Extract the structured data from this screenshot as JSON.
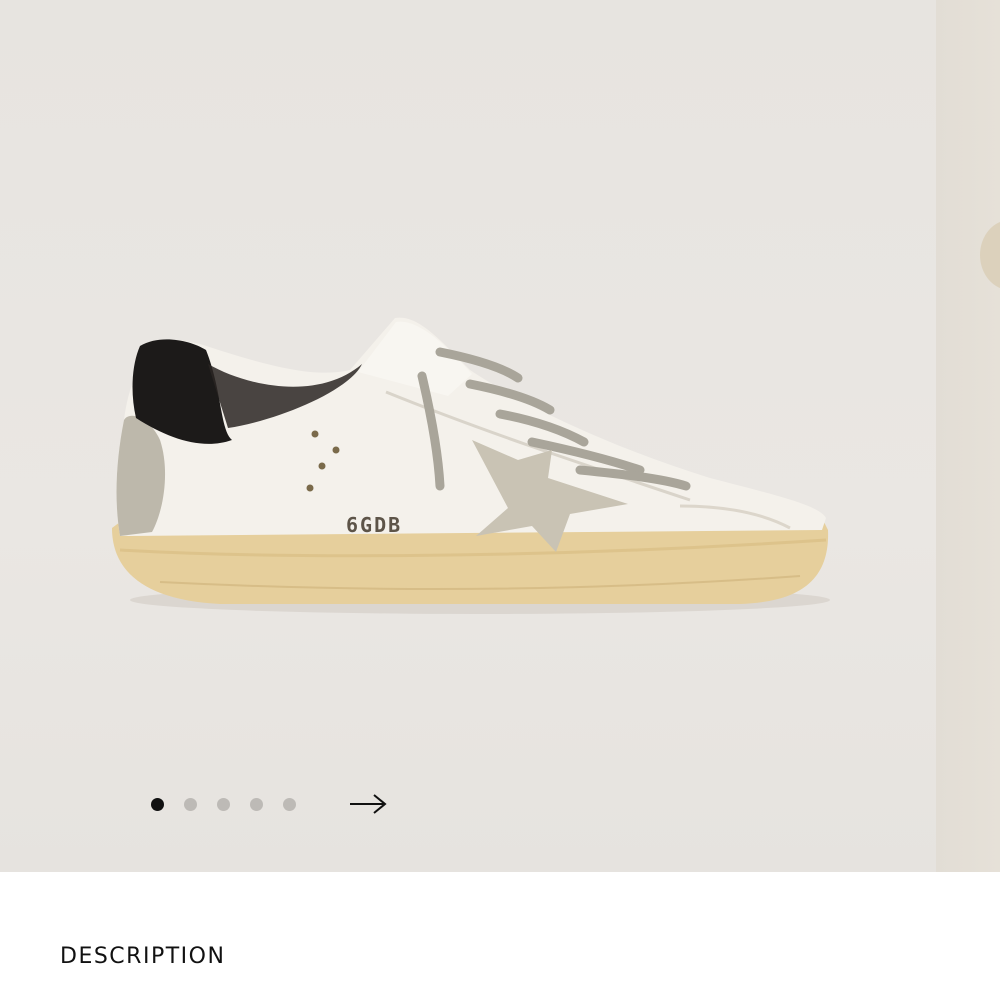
{
  "gallery": {
    "current_slide": 1,
    "total_slides": 5,
    "product_image": {
      "alt_semantic": "white-leather-sneaker-with-suede-star",
      "heel_stamp_text": "6GDB"
    },
    "next_arrow_icon": "arrow-right-icon"
  },
  "section": {
    "heading": "DESCRIPTION"
  },
  "colors": {
    "background": "#e9e6e2",
    "dot_active": "#111111",
    "dot_inactive": "#bdbab6",
    "text": "#111111"
  }
}
